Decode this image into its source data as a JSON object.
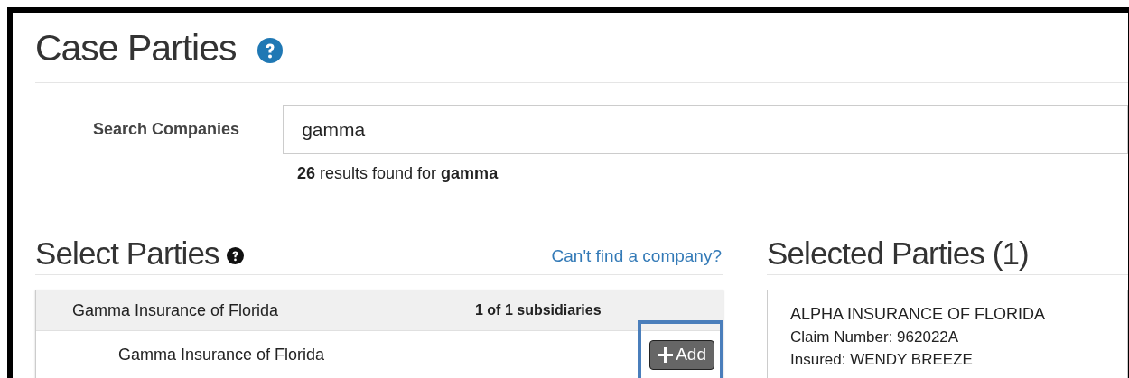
{
  "page": {
    "title": "Case Parties"
  },
  "search": {
    "label": "Search Companies",
    "value": "gamma",
    "results": "**26** results found for **gamma**"
  },
  "select_parties": {
    "heading": "Select Parties",
    "link": "Can't find a company?",
    "group": {
      "name": "Gamma Insurance of Florida",
      "subsidiaries": "1 of 1 subsidiaries"
    },
    "rows": [
      {
        "name": "Gamma Insurance of Florida",
        "button": "Add",
        "highlighted": true
      }
    ]
  },
  "selected_parties": {
    "heading": "Selected Parties (1)",
    "cards": [
      {
        "name": "ALPHA INSURANCE OF FLORIDA",
        "lines": [
          "Claim Number: 962022A",
          "Insured: WENDY BREEZE"
        ]
      }
    ]
  }
}
